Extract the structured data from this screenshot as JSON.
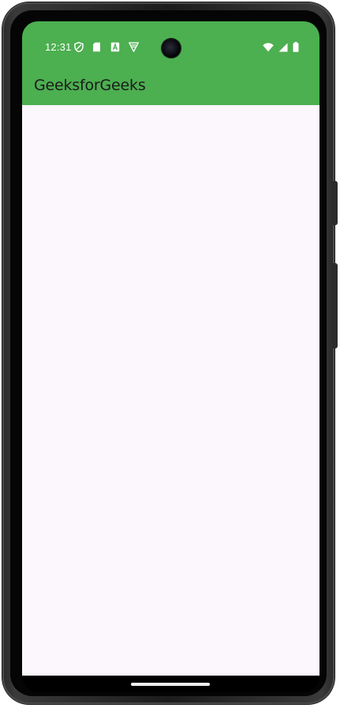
{
  "status_bar": {
    "time": "12:31",
    "background_color": "#4caf50",
    "left_icons": [
      "shield-icon",
      "sd-card-icon",
      "font-a-icon",
      "vpn-triangle-icon"
    ],
    "right_icons": [
      "wifi-icon",
      "signal-icon",
      "battery-icon"
    ]
  },
  "app_bar": {
    "title": "GeeksforGeeks",
    "background_color": "#4caf50"
  },
  "content": {
    "background_color": "#fcf7fd"
  },
  "navigation": {
    "type": "gesture",
    "background_color": "#000000"
  }
}
